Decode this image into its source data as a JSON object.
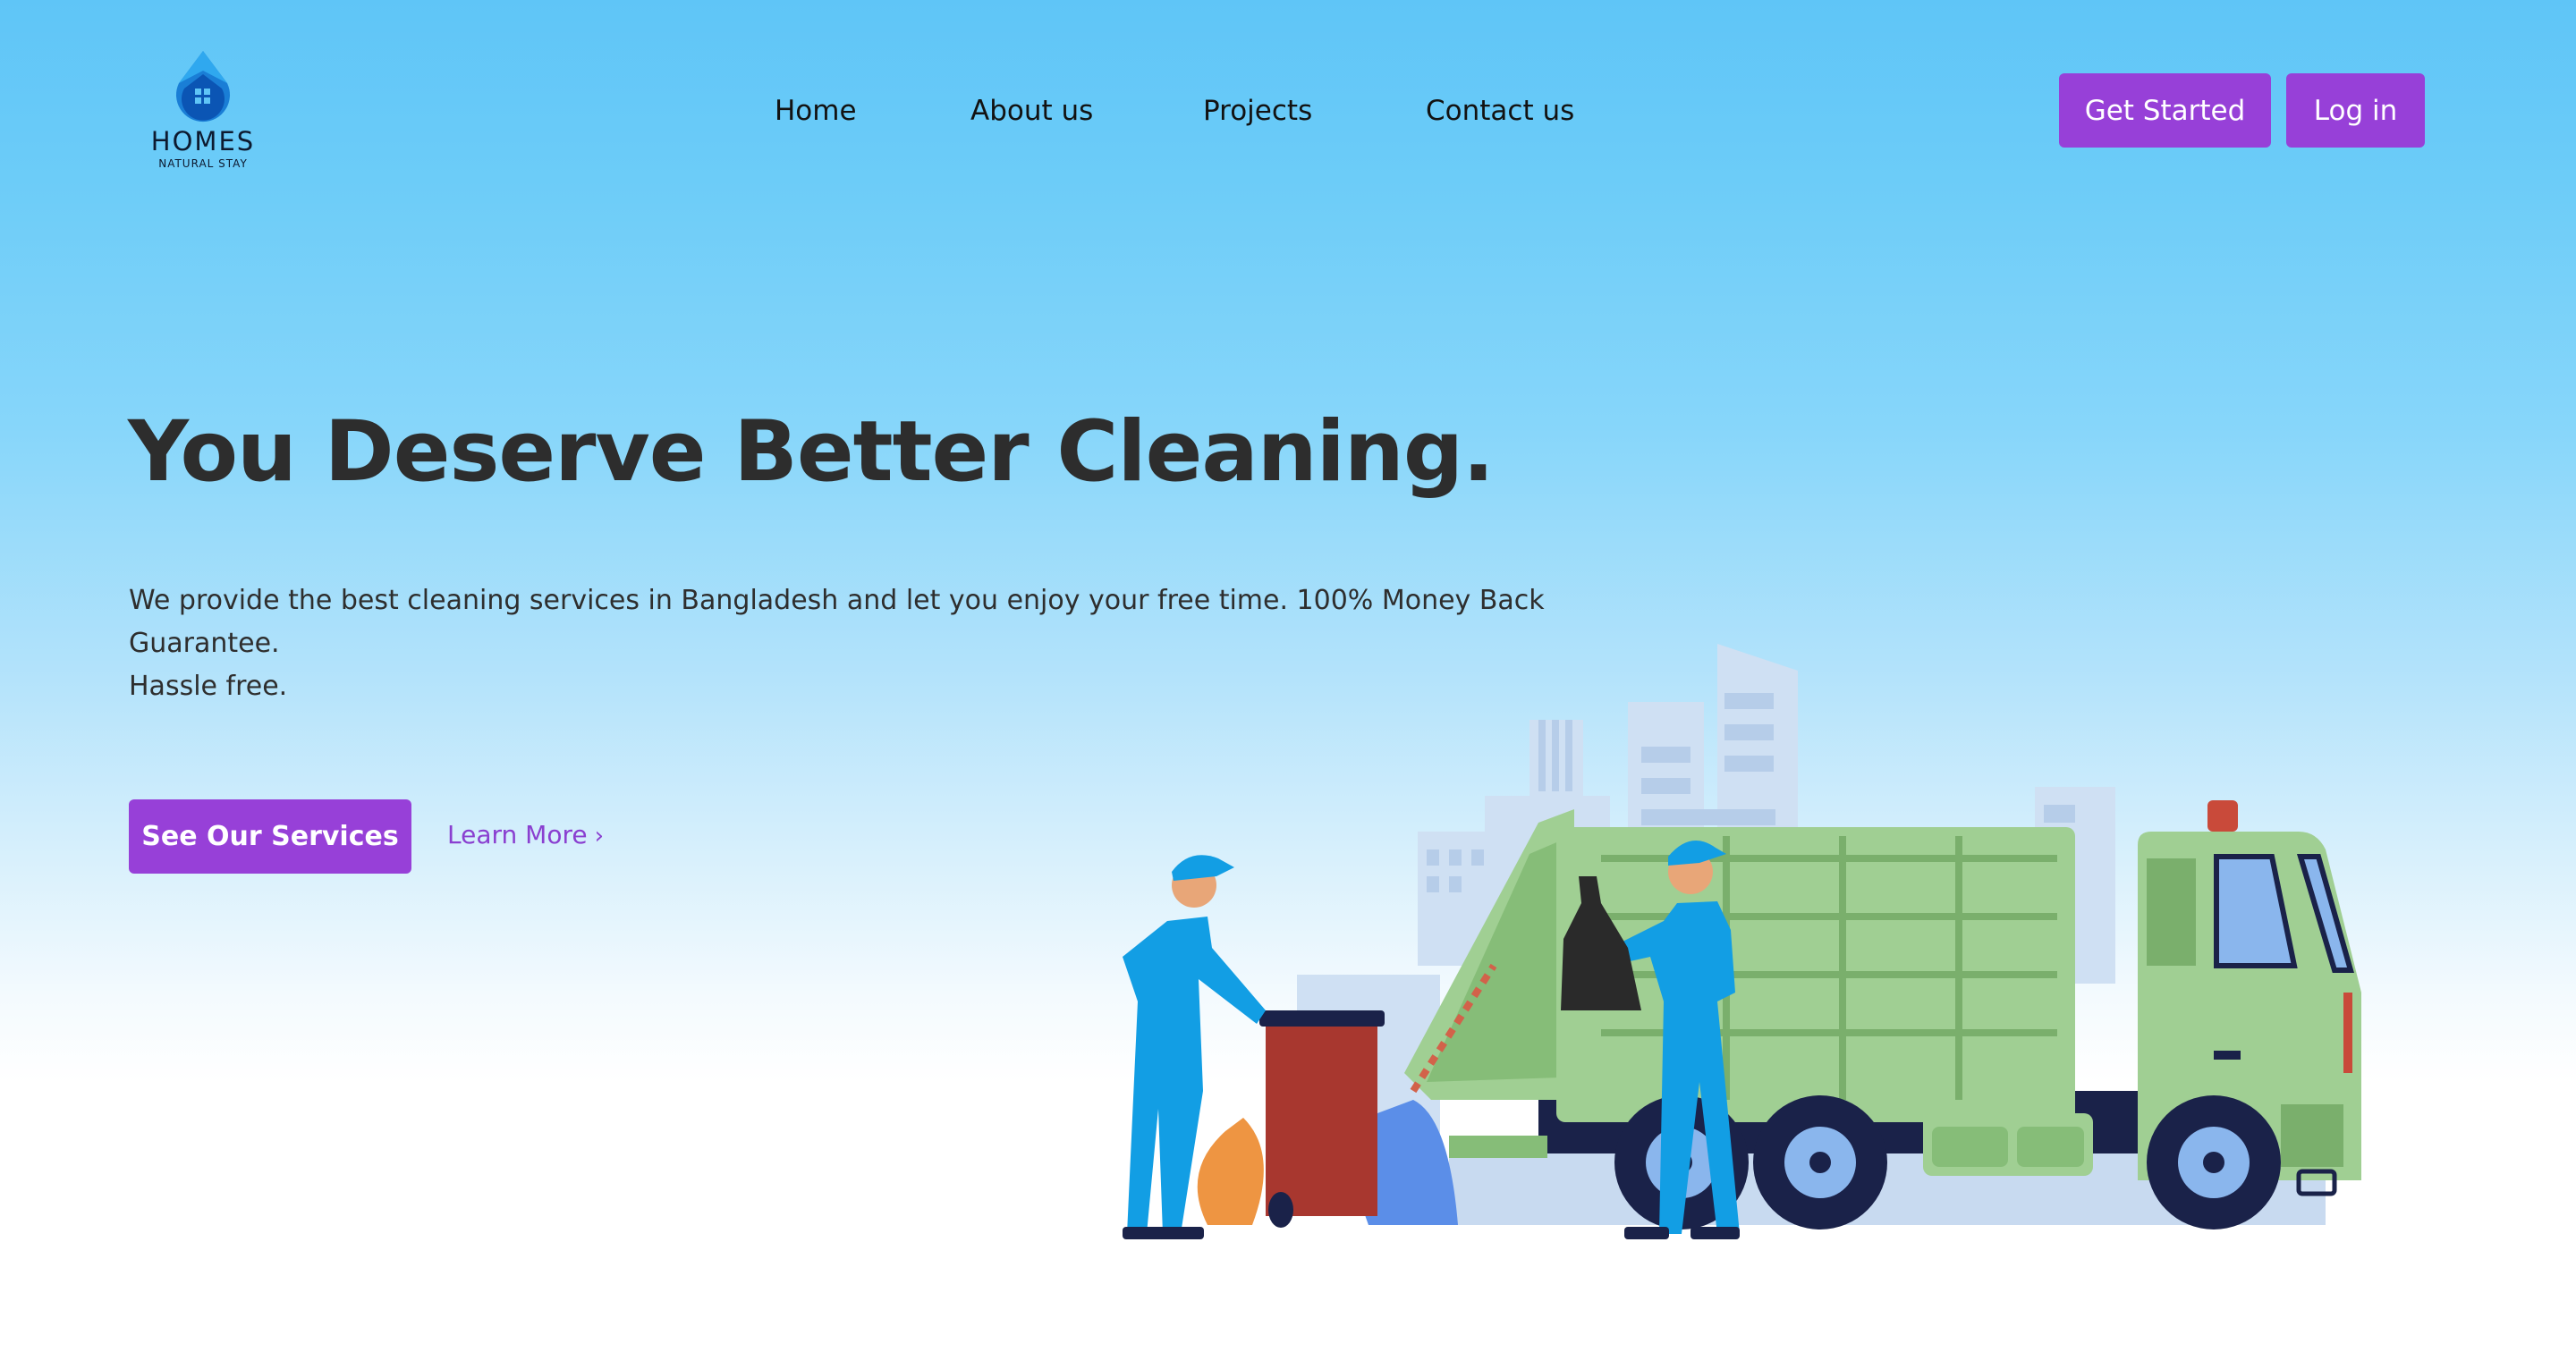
{
  "header": {
    "logo": {
      "brand": "HOMES",
      "tagline": "NATURAL STAY"
    },
    "nav": [
      {
        "label": "Home"
      },
      {
        "label": "About us"
      },
      {
        "label": "Projects"
      },
      {
        "label": "Contact us"
      }
    ],
    "get_started_label": "Get Started",
    "login_label": "Log in"
  },
  "hero": {
    "title": "You Deserve Better Cleaning.",
    "description_lines": [
      "We provide the best cleaning services in Bangladesh and let you enjoy your free time. 100% Money Back",
      "Guarantee.",
      "Hassle free."
    ],
    "primary_cta": "See Our Services",
    "secondary_cta": "Learn More",
    "secondary_cta_icon": "chevron-right-icon"
  },
  "illustration": {
    "subject": "garbage-truck-workers-illustration"
  },
  "colors": {
    "accent": "#9740d8",
    "sky_top": "#5fc5f7",
    "text_dark": "#2d2d2d",
    "truck_green": "#a0cf93",
    "worker_blue": "#129ee4"
  }
}
